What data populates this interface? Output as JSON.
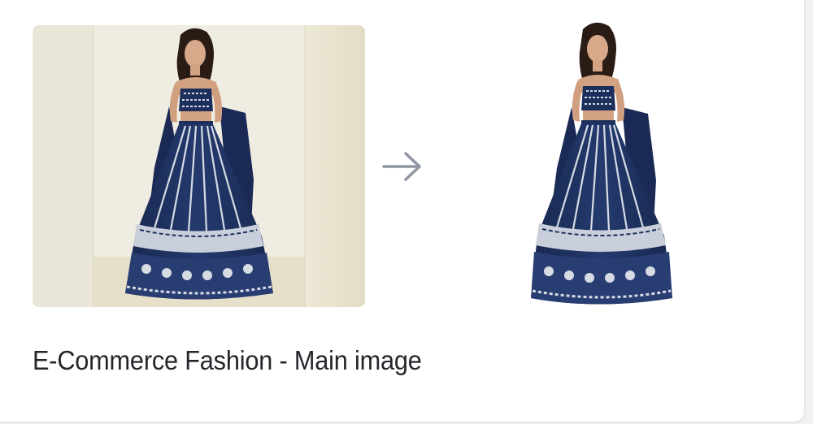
{
  "card": {
    "caption": "E-Commerce Fashion - Main image"
  },
  "images": {
    "before": {
      "subject": "model-in-navy-embroidered-lehenga",
      "background": "studio-backdrop"
    },
    "after": {
      "subject": "model-in-navy-embroidered-lehenga",
      "background": "transparent-removed"
    }
  },
  "arrow": {
    "icon": "arrow-right-icon",
    "color": "#8f95a3"
  },
  "colors": {
    "garment": "#1d2f5c",
    "embroidery": "#d6dbe4",
    "backdrop": "#ede9dc",
    "caption_text": "#23262b"
  }
}
